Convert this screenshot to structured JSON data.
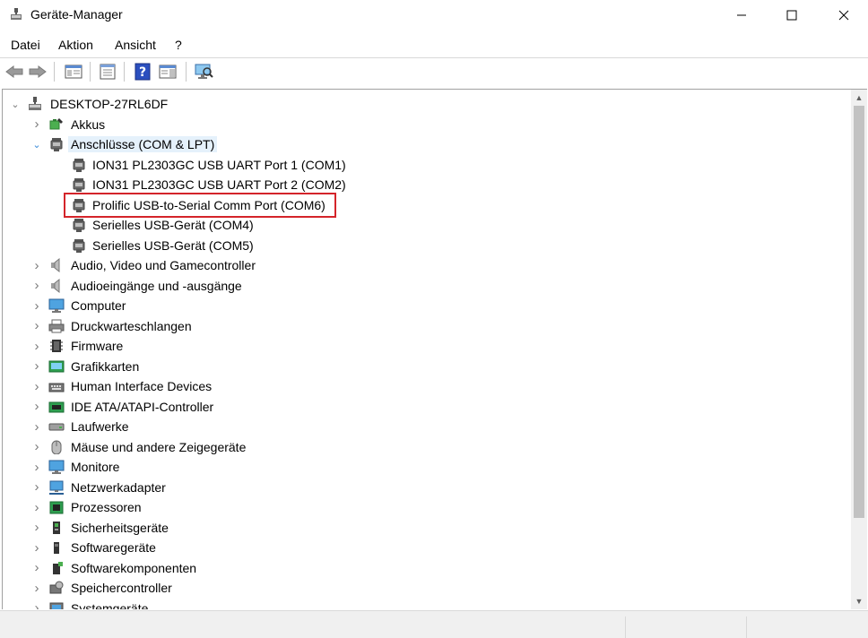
{
  "window": {
    "title": "Geräte-Manager"
  },
  "menu": [
    "Datei",
    "Aktion",
    "Ansicht",
    "?"
  ],
  "tree": {
    "root": "DESKTOP-27RL6DF",
    "categories": [
      {
        "label": "Akkus",
        "icon": "battery-icon",
        "expanded": false
      },
      {
        "label": "Anschlüsse (COM & LPT)",
        "icon": "port-icon",
        "expanded": true,
        "children": [
          "ION31 PL2303GC USB UART Port 1 (COM1)",
          "ION31 PL2303GC USB UART Port 2 (COM2)",
          "Prolific USB-to-Serial Comm Port (COM6)",
          "Serielles USB-Gerät (COM4)",
          "Serielles USB-Gerät (COM5)"
        ]
      },
      {
        "label": "Audio, Video und Gamecontroller",
        "icon": "speaker-icon",
        "expanded": false
      },
      {
        "label": "Audioeingänge und -ausgänge",
        "icon": "speaker-icon",
        "expanded": false
      },
      {
        "label": "Computer",
        "icon": "computer-icon",
        "expanded": false
      },
      {
        "label": "Druckwarteschlangen",
        "icon": "printer-icon",
        "expanded": false
      },
      {
        "label": "Firmware",
        "icon": "firmware-icon",
        "expanded": false
      },
      {
        "label": "Grafikkarten",
        "icon": "display-adapter-icon",
        "expanded": false
      },
      {
        "label": "Human Interface Devices",
        "icon": "hid-icon",
        "expanded": false
      },
      {
        "label": "IDE ATA/ATAPI-Controller",
        "icon": "ide-controller-icon",
        "expanded": false
      },
      {
        "label": "Laufwerke",
        "icon": "drive-icon",
        "expanded": false
      },
      {
        "label": "Mäuse und andere Zeigegeräte",
        "icon": "mouse-icon",
        "expanded": false
      },
      {
        "label": "Monitore",
        "icon": "monitor-icon",
        "expanded": false
      },
      {
        "label": "Netzwerkadapter",
        "icon": "network-adapter-icon",
        "expanded": false
      },
      {
        "label": "Prozessoren",
        "icon": "processor-icon",
        "expanded": false
      },
      {
        "label": "Sicherheitsgeräte",
        "icon": "security-device-icon",
        "expanded": false
      },
      {
        "label": "Softwaregeräte",
        "icon": "software-device-icon",
        "expanded": false
      },
      {
        "label": "Softwarekomponenten",
        "icon": "software-component-icon",
        "expanded": false
      },
      {
        "label": "Speichercontroller",
        "icon": "storage-controller-icon",
        "expanded": false
      },
      {
        "label": "Systemgeräte",
        "icon": "system-device-icon",
        "expanded": false
      }
    ]
  },
  "highlighted_item": "Prolific USB-to-Serial Comm Port (COM6)",
  "colors": {
    "highlight_border": "#d4242a",
    "selection_bg": "#e5f1fb"
  }
}
